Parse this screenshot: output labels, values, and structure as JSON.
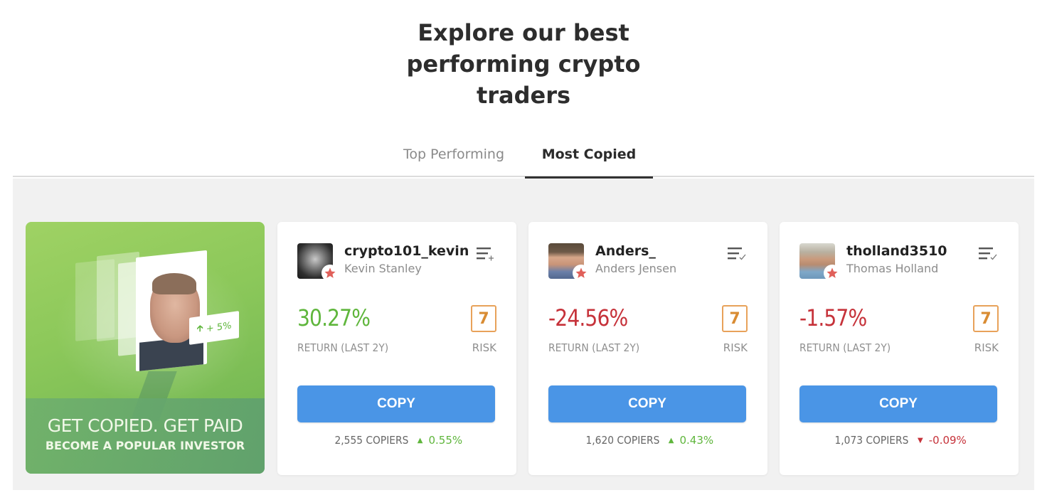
{
  "header": {
    "title_lines": [
      "Explore our best",
      "performing crypto",
      "traders"
    ]
  },
  "tabs": [
    {
      "label": "Top Performing",
      "active": false
    },
    {
      "label": "Most Copied",
      "active": true
    }
  ],
  "promo": {
    "badge_text": "+ 5%",
    "headline": "GET COPIED. GET PAID",
    "subline": "BECOME A POPULAR INVESTOR"
  },
  "traders": [
    {
      "username": "crypto101_kevin",
      "full_name": "Kevin Stanley",
      "list_icon": "watchlist-add-icon",
      "return_value": "30.27%",
      "return_label": "RETURN (LAST 2Y)",
      "risk_value": "7",
      "risk_label": "RISK",
      "copy_label": "COPY",
      "copiers": "2,555 COPIERS",
      "copiers_change": "0.55%",
      "trend": "up"
    },
    {
      "username": "Anders_",
      "full_name": "Anders Jensen",
      "list_icon": "watchlist-check-icon",
      "return_value": "-24.56%",
      "return_label": "RETURN (LAST 2Y)",
      "risk_value": "7",
      "risk_label": "RISK",
      "copy_label": "COPY",
      "copiers": "1,620 COPIERS",
      "copiers_change": "0.43%",
      "trend": "up"
    },
    {
      "username": "tholland3510",
      "full_name": "Thomas Holland",
      "list_icon": "watchlist-check-icon",
      "return_value": "-1.57%",
      "return_label": "RETURN (LAST 2Y)",
      "risk_value": "7",
      "risk_label": "RISK",
      "copy_label": "COPY",
      "copiers": "1,073 COPIERS",
      "copiers_change": "-0.09%",
      "trend": "down"
    }
  ],
  "colors": {
    "positive": "#5fb63c",
    "negative": "#c6323a",
    "copy_button": "#4a95e6",
    "risk": "#e8a25a",
    "star": "#e0605a"
  }
}
